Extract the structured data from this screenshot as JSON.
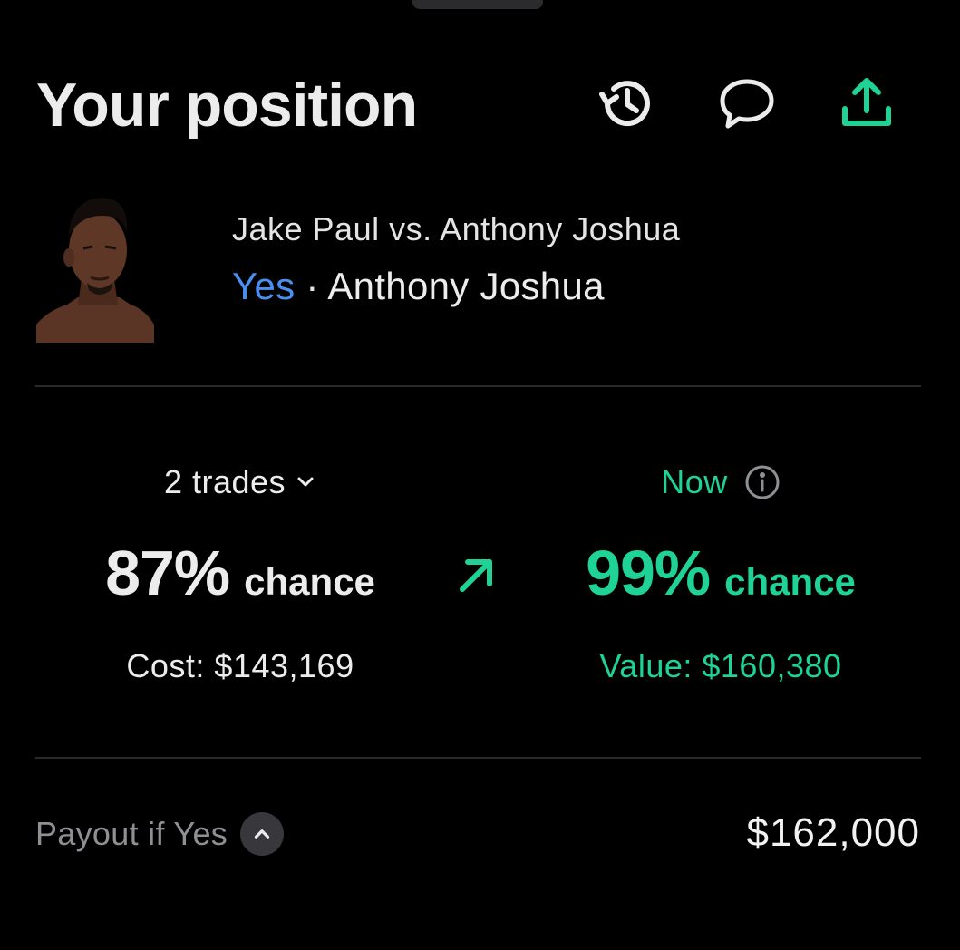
{
  "header": {
    "title": "Your position"
  },
  "icons": {
    "history": "history-icon",
    "comment": "comment-icon",
    "share": "share-upload-icon",
    "avatar": "fighter-portrait",
    "trend": "arrow-up-right-icon",
    "info": "info-icon",
    "chevron_down": "chevron-down-icon",
    "chevron_up": "chevron-up-icon"
  },
  "market": {
    "title": "Jake Paul vs. Anthony Joshua",
    "outcome_side": "Yes",
    "separator": "·",
    "outcome_name": "Anthony Joshua"
  },
  "position": {
    "trades_label": "2 trades",
    "entry_percent": "87%",
    "entry_chance_word": "chance",
    "cost_text": "Cost: $143,169",
    "now_label": "Now",
    "current_percent": "99%",
    "current_chance_word": "chance",
    "value_text": "Value: $160,380"
  },
  "payout": {
    "label": "Payout if Yes",
    "value": "$162,000"
  },
  "colors": {
    "background": "#000000",
    "text_primary": "#ececec",
    "text_muted": "#8f8f94",
    "accent_green": "#1fd397",
    "accent_blue": "#4a8ff0",
    "divider": "#2a2a2d"
  }
}
